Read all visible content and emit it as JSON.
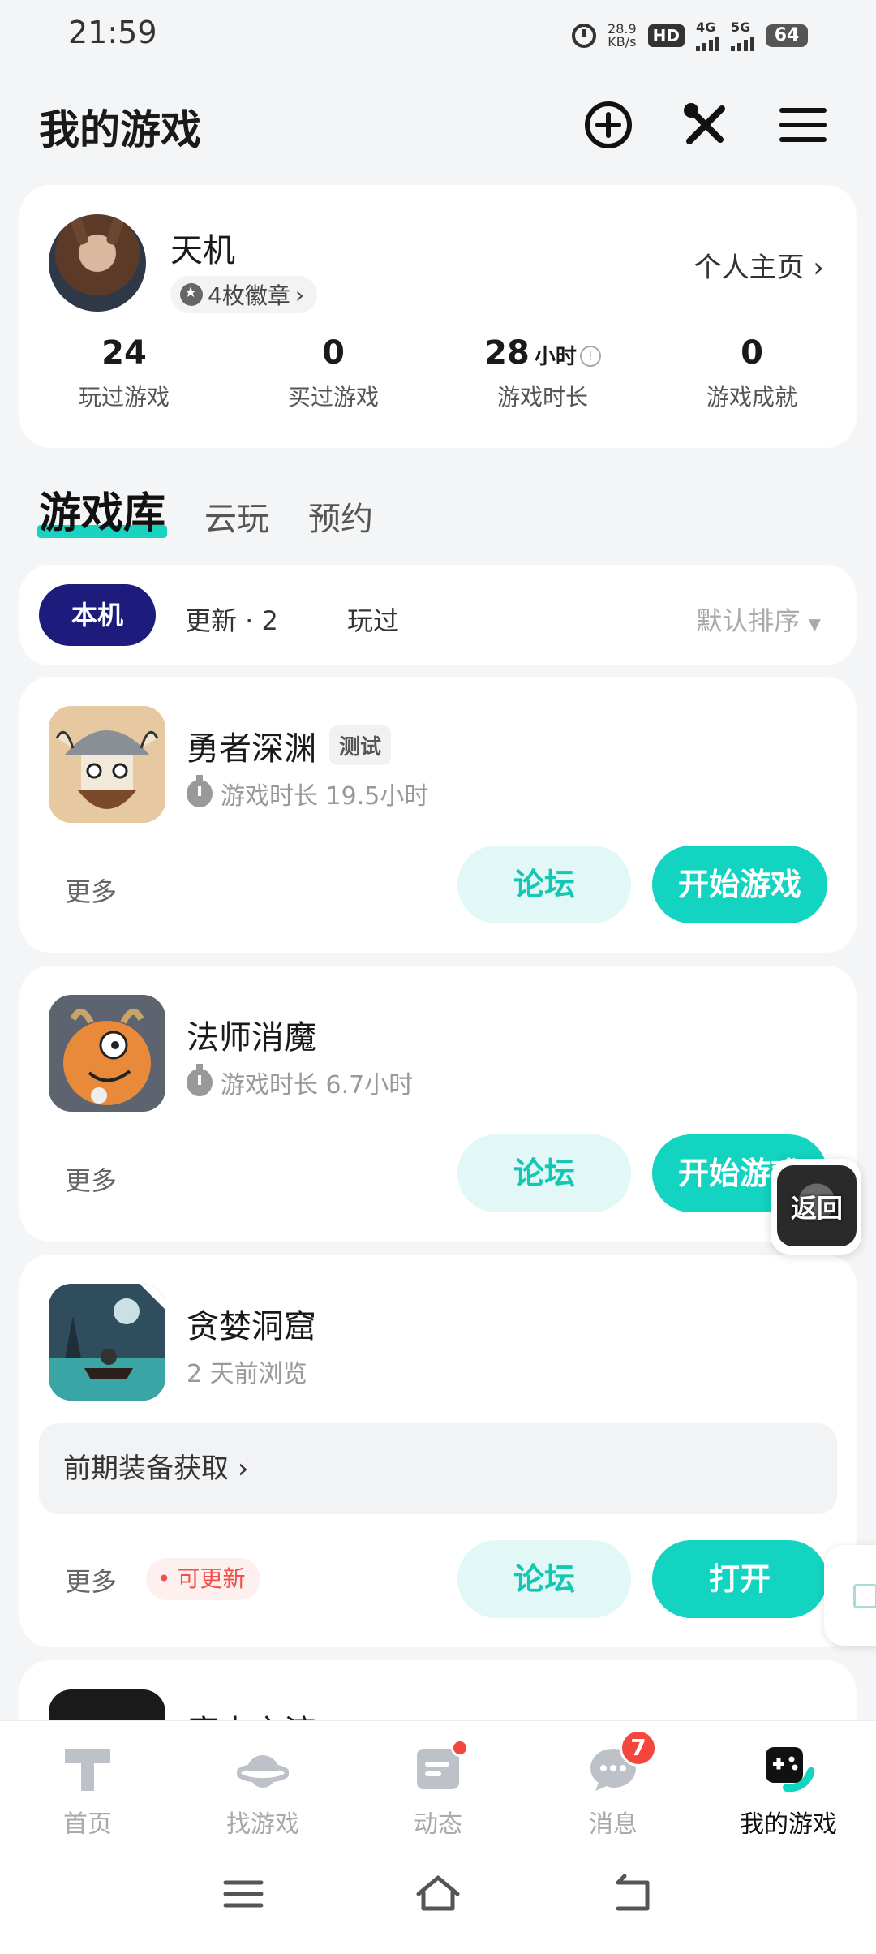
{
  "status_bar": {
    "time": "21:59",
    "net_speed_value": "28.9",
    "net_speed_unit": "KB/s",
    "hd_label": "HD",
    "signal1": "4G",
    "signal2": "5G",
    "battery": "64"
  },
  "header": {
    "title": "我的游戏",
    "icons": [
      "add-circle-icon",
      "tools-icon",
      "menu-icon"
    ]
  },
  "profile": {
    "username": "天机",
    "badges": "4枚徽章",
    "homepage_link": "个人主页",
    "stats": [
      {
        "value": "24",
        "unit": "",
        "label": "玩过游戏"
      },
      {
        "value": "0",
        "unit": "",
        "label": "买过游戏"
      },
      {
        "value": "28",
        "unit": "小时",
        "label": "游戏时长"
      },
      {
        "value": "0",
        "unit": "",
        "label": "游戏成就"
      }
    ]
  },
  "library_tabs": [
    "游戏库",
    "云玩",
    "预约"
  ],
  "filter": {
    "local": "本机",
    "update": "更新 · 2",
    "played": "玩过",
    "sort": "默认排序"
  },
  "games": [
    {
      "name": "勇者深渊",
      "tag": "测试",
      "subtitle": "游戏时长 19.5小时",
      "more": "更多",
      "forum": "论坛",
      "action": "开始游戏"
    },
    {
      "name": "法师消魔",
      "subtitle": "游戏时长 6.7小时",
      "more": "更多",
      "forum": "论坛",
      "action": "开始游戏"
    },
    {
      "name": "贪婪洞窟",
      "subtitle": "2 天前浏览",
      "tip": "前期装备获取",
      "more": "更多",
      "update_badge": "可更新",
      "forum": "论坛",
      "action": "打开"
    },
    {
      "name": "魔士之淀"
    }
  ],
  "floating": {
    "back": "返回"
  },
  "bottom_nav": [
    {
      "label": "首页",
      "icon": "home-t-icon"
    },
    {
      "label": "找游戏",
      "icon": "planet-icon"
    },
    {
      "label": "动态",
      "icon": "feed-icon"
    },
    {
      "label": "消息",
      "icon": "chat-icon",
      "badge": "7"
    },
    {
      "label": "我的游戏",
      "icon": "gamepad-icon"
    }
  ],
  "colors": {
    "accent": "#12d4c0",
    "chip_dark": "#1d1b7b",
    "badge_red": "#f5463e"
  }
}
